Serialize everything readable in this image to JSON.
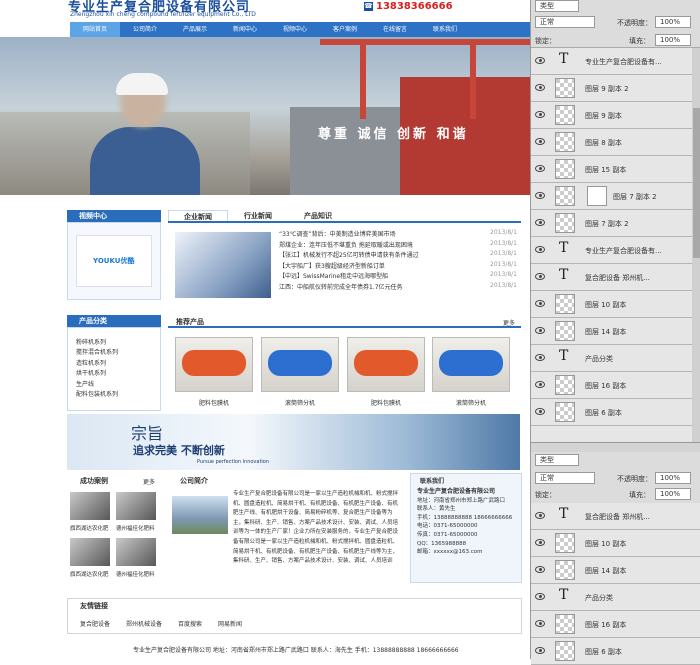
{
  "site": {
    "company_cn": "专业生产复合肥设备有限公司",
    "company_en": "Zhengzhou xin cheng compound fertilizer equipment Co., LTD",
    "phone": "13838366666",
    "nav": [
      "网站首页",
      "公司简介",
      "产品展示",
      "新闻中心",
      "视频中心",
      "客户案例",
      "在线留言",
      "联系我们"
    ],
    "slogan": "尊重 诚信 创新 和谐",
    "video_title": "视频中心",
    "video_brand": "YOUKU优酷",
    "category_title": "产品分类",
    "categories": [
      "粉碎机系列",
      "搅拌混合机系列",
      "造粒机系列",
      "烘干机系列",
      "生产线",
      "配料包装机系列"
    ],
    "tabs": [
      "企业新闻",
      "行业新闻",
      "产品知识"
    ],
    "news": [
      {
        "title": "“33℃调查”背后：中美制造业博弈美国市场",
        "date": "2013/8/1"
      },
      {
        "title": "郑煤企业：连年压低不堪重负 拖延取暖或出现困境",
        "date": "2013/8/1"
      },
      {
        "title": "【张江】机械发行不超25亿可转债申请获有条件通过",
        "date": "2013/8/1"
      },
      {
        "title": "【大宇船厂】获3艘超级经济型新船订单",
        "date": "2013/8/1"
      },
      {
        "title": "【中远】SwissMarine租走中远海哪型船",
        "date": "2013/8/1"
      },
      {
        "title": "江西：中船航仪转前完成全年债券1.7亿元任务",
        "date": "2013/8/1"
      }
    ],
    "products_title": "推荐产品",
    "more": "更多",
    "products": [
      "肥料包膜机",
      "滚筒筛分机",
      "肥料包膜机",
      "滚筒筛分机"
    ],
    "ad_title": "宗旨",
    "ad_sub": "追求完美 不断创新",
    "ad_en": "Pursue perfection innovation",
    "cases_title": "成功案例",
    "cases": [
      "旗西湖达农化肥",
      "德州福佳化肥料",
      "旗西湖达农化肥",
      "德州福佳化肥料"
    ],
    "intro_title": "公司简介",
    "intro_text": "专业生产复合肥设备有限公司是一家以生产造粒机械和机、粉式搅拌机、圆盘造粒机、简易烘干机、有机肥设备、有机肥生产设备、有机肥生产线、有机肥烘干设备、简易粉碎机等、复合肥生产设备等为主，集科研、生产、销售、方案产品技术设计、安装、调试、人员培训等为一体的生产厂家！企业力所在安装服务的，专业生产复合肥设备有限公司是一家以生产造粒机械和机、粉式搅拌机、圆盘造粒机、简易烘干机、有机肥设备、有机肥生产设备、有机肥生产线等为主，集科研、生产、销售、方案产品技术设计、安装、调试、人员培训",
    "contact_title": "联系我们",
    "contact": [
      "专业生产复合肥设备有限公司",
      "地址：河南省郑州市郑上路广武路口",
      "联系人：黄先生",
      "手机：13888888888 18666666666",
      "电话：0371-65000000",
      "传真：0371-65000000",
      "QQ：1365988888",
      "邮箱：xxxxxx@163.com"
    ],
    "links_title": "友情链接",
    "links": [
      "复合肥设备",
      "郑州机械设备",
      "百度搜索",
      "网易新闻"
    ],
    "footer": "专业生产复合肥设备有限公司    地址：河南省郑州市郑上路广武路口    联系人：海先生    手机：13888888888 18666666666"
  },
  "ps_panel": {
    "top_tab": "类型",
    "blend": "正常",
    "opacity_label": "不透明度：",
    "opacity": "100%",
    "lock_label": "锁定：",
    "fill_label": "填充：",
    "fill": "100%",
    "layers": [
      {
        "type": "text",
        "name": "专业生产复合肥设备有..."
      },
      {
        "type": "pixel",
        "name": "图层 9 副本 2"
      },
      {
        "type": "pixel",
        "name": "图层 9 副本"
      },
      {
        "type": "pixel",
        "name": "图层 8 副本"
      },
      {
        "type": "pixel",
        "name": "图层 15 副本"
      },
      {
        "type": "mask",
        "name": "图层 7 副本 2"
      },
      {
        "type": "pixel",
        "name": "图层 7 副本 2"
      },
      {
        "type": "text",
        "name": "专业生产复合肥设备有..."
      },
      {
        "type": "text",
        "name": "复合肥设备    郑州机..."
      },
      {
        "type": "pixel",
        "name": "图层 10 副本"
      },
      {
        "type": "pixel",
        "name": "图层 14 副本"
      },
      {
        "type": "text",
        "name": "产品分类"
      },
      {
        "type": "pixel",
        "name": "图层 16 副本"
      },
      {
        "type": "pixel",
        "name": "图层 6 副本"
      }
    ],
    "layers2": [
      {
        "type": "text",
        "name": "复合肥设备    郑州机..."
      },
      {
        "type": "pixel",
        "name": "图层 10 副本"
      },
      {
        "type": "pixel",
        "name": "图层 14 副本"
      },
      {
        "type": "text",
        "name": "产品分类"
      },
      {
        "type": "pixel",
        "name": "图层 16 副本"
      },
      {
        "type": "pixel",
        "name": "图层 6 副本"
      }
    ]
  }
}
